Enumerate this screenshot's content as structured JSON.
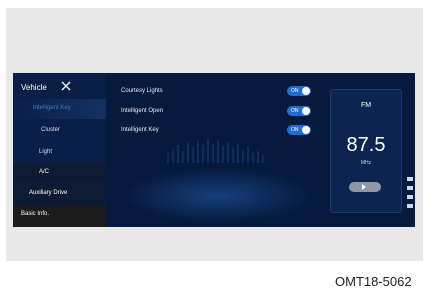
{
  "sidebar": {
    "title": "Vehicle",
    "items": [
      {
        "label": "Intelligent Key"
      },
      {
        "label": "Cluster"
      },
      {
        "label": "Light"
      },
      {
        "label": "A/C"
      },
      {
        "label": "Auxiliary Drive"
      },
      {
        "label": "Basic Info."
      }
    ]
  },
  "settings": [
    {
      "label": "Courtesy Lights",
      "state": "ON"
    },
    {
      "label": "Intelligent Open",
      "state": "ON"
    },
    {
      "label": "Intelligent Key",
      "state": "ON"
    }
  ],
  "fm": {
    "title": "FM",
    "frequency": "87.5",
    "unit": "MHz"
  },
  "footer": {
    "code": "OMT18-5062"
  },
  "colors": {
    "screen_bg": "#061a3d",
    "toggle_on": "#1e6ed1",
    "active_menu": "#4e7fd6"
  }
}
